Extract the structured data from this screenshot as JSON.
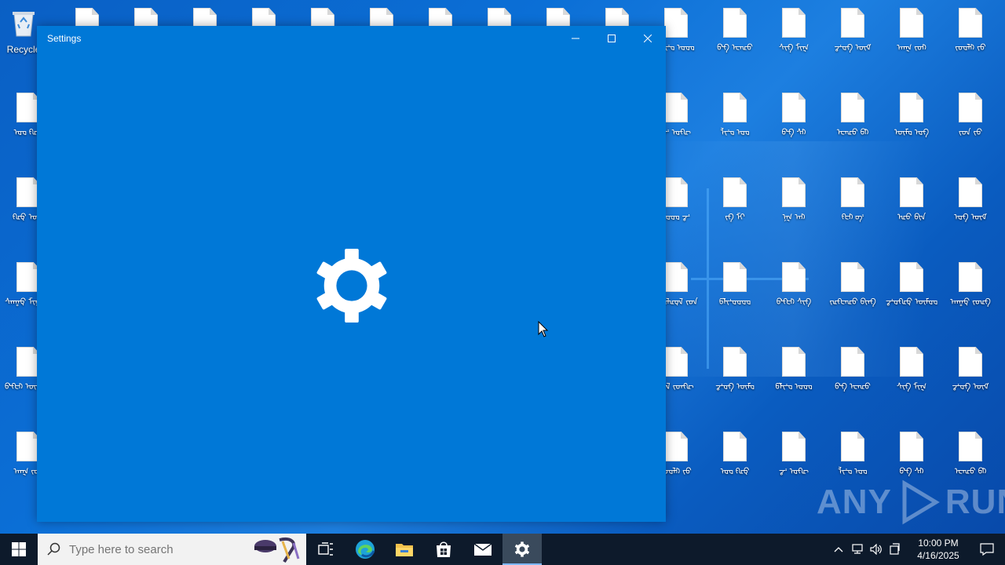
{
  "desktop": {
    "recycle_bin_label": "Recycle",
    "icons": [
      {
        "label": "ᠰᠡᠨᡎᡇ ᠮᠢᡎᡇᠰ"
      },
      {
        "label": "ᡕᠤᡆᠯᡅᡇᠯ ᡪᠤᠨ"
      },
      {
        "label": "ᡦᠯᡞᡃᡆᡆᡆᡆ"
      },
      {
        "label": "ᡋᡃᡍᡄᡅ ᠰᡕᡍ"
      },
      {
        "label": "ᠵᡅᡍᡄᡅᠣ ᡋᡕᠨᡍ"
      },
      {
        "label": "ᡒᡃᡆᡍᡅᡇ ᠦᡏᡆᡆ"
      },
      {
        "label": "ᠠᠨᡎᡇ ᡕᠤᡅᡍ"
      },
      {
        "label": "ᡋᡃᡍᡄᡅ ᠦᡆᡍᡅ"
      },
      {
        "label": "ᡕᠤᠯ ᡪᠤᠨᡍᡅ"
      },
      {
        "label": "ᡒᡃᡆᡍ ᠦᡏᡆ"
      },
      {
        "label": "ᡦᠯᡞᡃᡆ ᡆᡆᡆ"
      },
      {
        "label": "ᡋᡃᡍ ᡄᡅᠣ"
      },
      {
        "label": "ᠰᡕᡍ ᠮᠢᡎ"
      },
      {
        "label": "ᡒᡃᡆᡍ ᠦᡏ"
      },
      {
        "label": "ᠠᠨᡎ ᡕᠤᡅ"
      },
      {
        "label": "ᡕᠤᡆᠯᡅ ᡪᠤ"
      },
      {
        "label": "ᡆᡆ ᡍᡅᡇ"
      },
      {
        "label": "ᡒᡃ ᡆᡍᡅ"
      },
      {
        "label": "ᠯᡞᡃᡆ ᡆᡆ"
      },
      {
        "label": "ᡋᡃᡍ ᠰᡕ"
      },
      {
        "label": "ᡄᡅᠣ ᡋᡕ"
      },
      {
        "label": "ᠦᡏᡆ ᡆᡍ"
      },
      {
        "label": "ᡪᠤᠨ ᡕᠤ"
      },
      {
        "label": "ᡍᡅᡇ ᠦᡆ"
      },
      {
        "label": "ᡆᡆᡆ ᡒᡃ"
      },
      {
        "label": "ᡕᡍ ᠮᠢ"
      },
      {
        "label": "ᠨᡎ ᠠᡅ"
      },
      {
        "label": "ᡍᡄᡅ ᡋᡃ"
      },
      {
        "label": "ᡅᠣ ᡋᡕᠨ"
      },
      {
        "label": "ᡆᡍ ᠦᡏ"
      }
    ]
  },
  "settings_window": {
    "title": "Settings",
    "minimize_label": "–",
    "maximize_label": "□",
    "close_label": "✕",
    "splash_icon": "gear-icon"
  },
  "watermark": {
    "text_left": "ANY",
    "text_right": "RUN"
  },
  "taskbar": {
    "start_icon": "windows-logo-icon",
    "search_placeholder": "Type here to search",
    "apps": [
      {
        "name": "task-view",
        "icon": "task-view-icon"
      },
      {
        "name": "edge",
        "icon": "edge-icon"
      },
      {
        "name": "file-explorer",
        "icon": "folder-icon"
      },
      {
        "name": "microsoft-store",
        "icon": "store-icon"
      },
      {
        "name": "mail",
        "icon": "mail-icon"
      },
      {
        "name": "settings",
        "icon": "gear-icon",
        "active": true
      }
    ],
    "clock_time": "10:00 PM",
    "clock_date": "4/16/2025"
  }
}
